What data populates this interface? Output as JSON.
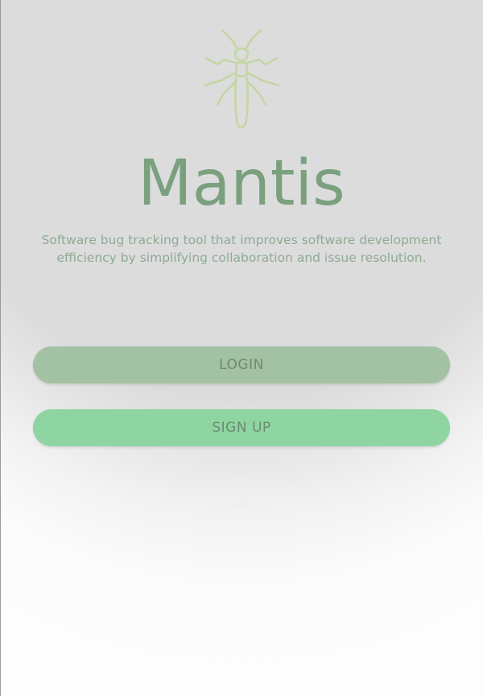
{
  "app": {
    "title": "Mantis",
    "tagline": "Software bug tracking tool that improves software development efficiency by simplifying collaboration and issue resolution.",
    "logo_icon": "mantis-insect-icon"
  },
  "actions": {
    "login_label": "LOGIN",
    "signup_label": "SIGN UP"
  },
  "colors": {
    "accent": "#7aa07e",
    "login_button": "#a3c2a3",
    "signup_button": "#8ed5a2",
    "background": "#dcdcdd"
  }
}
